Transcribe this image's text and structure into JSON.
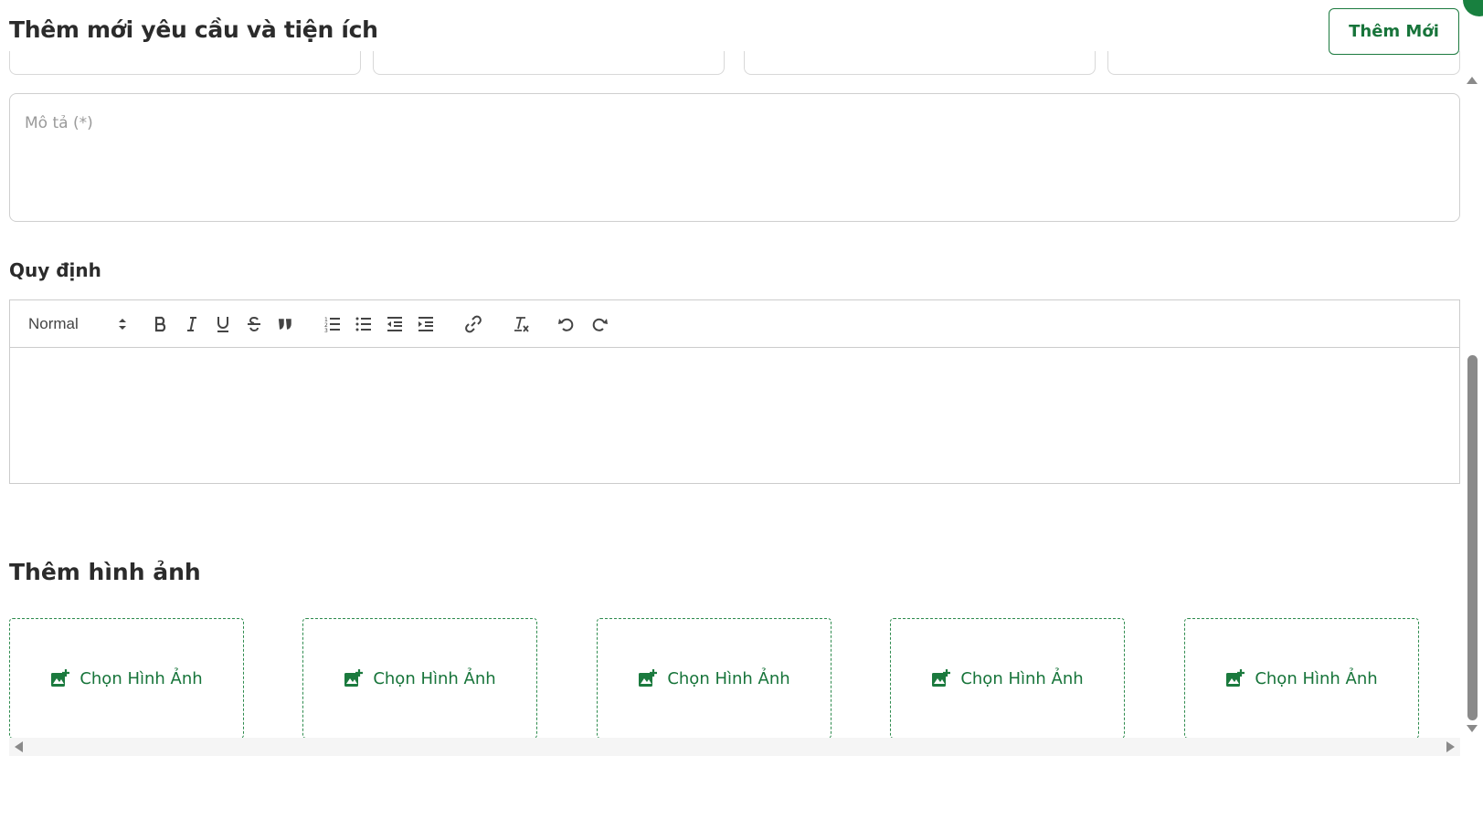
{
  "header": {
    "title": "Thêm mới yêu cầu và tiện ích",
    "add_new_label": "Thêm Mới"
  },
  "form": {
    "description_placeholder": "Mô tả (*)",
    "rules_label": "Quy định"
  },
  "editor": {
    "format_value": "Normal",
    "toolbar_icons": [
      "bold-icon",
      "italic-icon",
      "underline-icon",
      "strikethrough-icon",
      "blockquote-icon",
      "ordered-list-icon",
      "bullet-list-icon",
      "outdent-icon",
      "indent-icon",
      "link-icon",
      "clear-format-icon",
      "undo-icon",
      "redo-icon"
    ]
  },
  "images": {
    "title": "Thêm hình ảnh",
    "slots": [
      {
        "label": "Chọn Hình Ảnh"
      },
      {
        "label": "Chọn Hình Ảnh"
      },
      {
        "label": "Chọn Hình Ảnh"
      },
      {
        "label": "Chọn Hình Ảnh"
      },
      {
        "label": "Chọn Hình Ảnh"
      }
    ]
  },
  "colors": {
    "accent": "#17743a",
    "border": "#cfcfcf"
  }
}
